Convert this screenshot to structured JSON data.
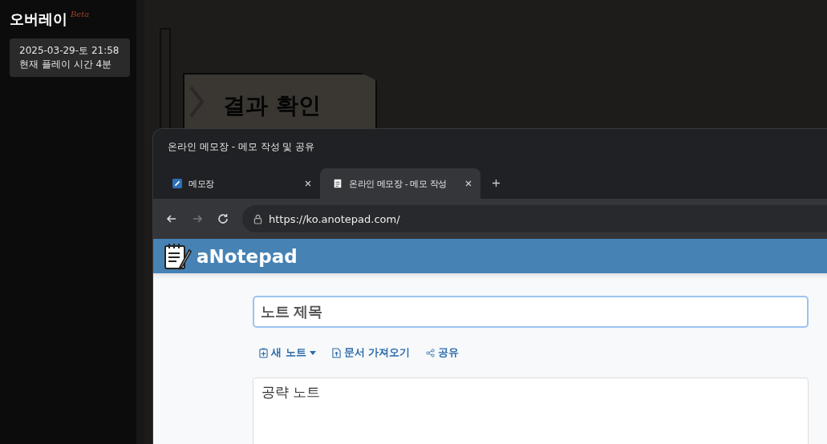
{
  "overlay": {
    "title": "오버레이",
    "badge": "Beta",
    "date": "2025-03-29-토 21:58",
    "playtime": "현재 플레이 시간 4분"
  },
  "game": {
    "button": "결과 확인"
  },
  "window": {
    "title": "온라인 메모장 - 메모 작성 및 공유"
  },
  "tabs": [
    {
      "label": "메모장",
      "selected": false
    },
    {
      "label": "온라인 메모장 - 메모 작성",
      "selected": true
    }
  ],
  "address_bar": {
    "url": "https://ko.anotepad.com/"
  },
  "page": {
    "logo": "aNotepad",
    "title_field": {
      "placeholder": "노트 제목"
    },
    "actions": [
      {
        "label": "새 노트",
        "kind": "new",
        "dropdown": true
      },
      {
        "label": "문서 가져오기",
        "kind": "import",
        "dropdown": false
      },
      {
        "label": "공유",
        "kind": "share",
        "dropdown": false
      }
    ],
    "note": {
      "value": "공략 노트"
    }
  }
}
